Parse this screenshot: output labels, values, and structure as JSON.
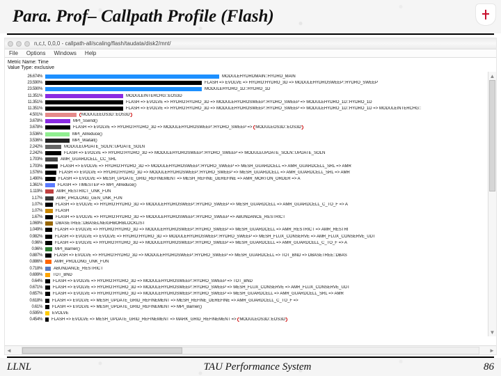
{
  "slide": {
    "title": "Para. Prof– Callpath Profile (Flash)",
    "footer_left": "LLNL",
    "footer_center": "TAU Performance System",
    "footer_right": "86"
  },
  "window": {
    "title": "n,c,t, 0,0,0 - callpath-all/scaling/flash/taudata/disk2/mnt/",
    "menus": [
      "File",
      "Options",
      "Windows",
      "Help"
    ],
    "metric_name": "Metric Name: Time",
    "value_type": "Value Type: exclusive"
  },
  "rows": [
    {
      "pct": "26.674%",
      "color": "#1d90ff",
      "len": 250,
      "label": "MODULEHYDROMAIN::HYDRO_MAIN"
    },
    {
      "pct": "23.590%",
      "color": "#000000",
      "len": 225,
      "label": "FLASH  =>  EVOLVE  => HYDRO:HYDRO_3D  =>  MODULEHYDROSWEEP::HYDRO_SWEEP"
    },
    {
      "pct": "23.590%",
      "color": "#1d90ff",
      "len": 225,
      "label": "MODULEHYDRO_1D::HYDRO_1D"
    },
    {
      "pct": "11.351%",
      "color": "#8a2be2",
      "len": 112,
      "label": "MODULEINTERCHG::EOS3D"
    },
    {
      "pct": "11.351%",
      "color": "#000000",
      "len": 112,
      "label": "FLASH  =>  EVOLVE  => HYDRO:HYDRO_3D  =>  MODULEHYDROSWEEP::HYDRO_SWEEP  =>  MODULEHYDRO_1D::HYDRO_1D"
    },
    {
      "pct": "11.351%",
      "color": "#000000",
      "len": 112,
      "label": "FLASH  =>  EVOLVE  => HYDRO:HYDRO_3D  =>  MODULEHYDROSWEEP::HYDRO_SWEEP  =>  MODULEHYDRO_1D::HYDRO_1D  =>  MODULEINTERCHG::"
    },
    {
      "pct": "4.501%",
      "color": "#e68a8a",
      "len": 45,
      "label": "MODULEEOS3D::EOS3D",
      "mark": true
    },
    {
      "pct": "3.678%",
      "color": "#8a2be2",
      "len": 36,
      "label": "MPI_Ssend()"
    },
    {
      "pct": "3.678%",
      "color": "#000000",
      "len": 36,
      "label": "FLASH  =>  EVOLVE  =>  HYDRO:HYDRO_3D  =>  MODULEHYDROSWEEP::HYDRO_SWEEP  =>  MODULEOS3D::EOS3D",
      "mark2": true
    },
    {
      "pct": "3.536%",
      "color": "#90ee90",
      "len": 35,
      "label": "MPI_Allreduce()"
    },
    {
      "pct": "3.536%",
      "color": "#222222",
      "len": 35,
      "label": "MPI_Waitall()"
    },
    {
      "pct": "2.242%",
      "color": "#666666",
      "len": 23,
      "label": "MODULEUPDATE_SOLN::UPDATE_SOLN"
    },
    {
      "pct": "2.242%",
      "color": "#000000",
      "len": 23,
      "label": "FLASH  =>  EVOLVE  => HYDRO:HYDRO_3D  =>  MODULEHYDROSWEEP::HYDRO_SWEEP  =>  MODULEUPDATE_SOLN::UPDATE_SOLN"
    },
    {
      "pct": "1.703%",
      "color": "#444444",
      "len": 18,
      "label": "AMR_GUARDCELL_CC_SRL"
    },
    {
      "pct": "1.703%",
      "color": "#000000",
      "len": 18,
      "label": "FLASH  =>  EVOLVE  =>  HYDRO:HYDRO_3D  =>  MODULEHYDROSWEEP::HYDRO_SWEEP  =>  MESH_GUARDCELL  =>  AMR_GUARDCELL_SRL  =>  AMR"
    },
    {
      "pct": "1.576%",
      "color": "#000000",
      "len": 16,
      "label": "FLASH  =>  EVOLVE  =>  HYDRO:HYDRO_3D  =>  MODULEHYDROSWEEP::HYDRO_SWEEP  =>  MESH_GUARDCELL  =>  AMR_GUARDCELL_SRL  =>  AMR"
    },
    {
      "pct": "1.490%",
      "color": "#000000",
      "len": 15,
      "label": "FLASH  =>  EVOLVE  =>  MESH_UPDATE_GRID_REFINEMENT  =>  MESH_REFINE_DEREFINE  =>  AMR_MORTON_ORDER  =>  A"
    },
    {
      "pct": "1.361%",
      "color": "#5a7aff",
      "len": 14,
      "label": "FLASH  =>  TIMESTEP  =>  MPI_Allreduce()"
    },
    {
      "pct": "1.119%",
      "color": "#c04040",
      "len": 12,
      "label": "AMR_RESTRICT_UNK_FUN"
    },
    {
      "pct": "1.17%",
      "color": "#3a3a3a",
      "len": 12,
      "label": "AMR_PROLONG_GEN_UNK_FUN"
    },
    {
      "pct": "1.07%",
      "color": "#000000",
      "len": 11,
      "label": "FLASH  =>  EVOLVE  => HYDRO:HYDRO_3D  =>  MODULEHYDROSWEEP::HYDRO_SWEEP  =>  MESH_GUARDCELL  =>  AMR_GUARDCELL_C_TO_F  =>  A"
    },
    {
      "pct": "1.07%",
      "color": "#cc8800",
      "len": 11,
      "label": "FLASH"
    },
    {
      "pct": "1.67%",
      "color": "#000000",
      "len": 11,
      "label": "FLASH  =>  EVOLVE  =>  HYDRO:HYDRO_3D  =>  MODULEHYDROSWEEP::HYDRO_SWEEP  =>  ABUNDANCE_RESTRICT"
    },
    {
      "pct": "1.069%",
      "color": "#996600",
      "len": 11,
      "label": "DBASETREE::DBASELNEIGHBORBLOCKLIST"
    },
    {
      "pct": "1.049%",
      "color": "#000000",
      "len": 10,
      "label": "FLASH  =>  EVOLVE  =>  HYDRO:HYDRO_3D  =>  MODULEHYDROSWEEP::HYDRO_SWEEP  =>  MESH_GUARDCELL  =>  AMR_RESTRICT  =>  AMR_RESTRI"
    },
    {
      "pct": "0.982%",
      "color": "#000000",
      "len": 10,
      "label": "FLASH  =>  EVOLVE  =>  EVOLVE  =>  HYDRO:HYDRO_3D  =>  MODULEHYDROSWEEP::HYDRO_SWEEP  =>  MESH_FLUX_CONSERVE  =>  AMR_FLUX_CONSERVE_UDT"
    },
    {
      "pct": "0.96%",
      "color": "#000000",
      "len": 10,
      "label": "FLASH  =>  EVOLVE  =>  HYDRO:HYDRO_3D  =>  MODULEHYDROSWEEP::HYDRO_SWEEP  =>  MESH_GUARDCELL  =>  AMR_GUARDCELL_C_TO_F  =>  A"
    },
    {
      "pct": "0.96%",
      "color": "#2e7d32",
      "len": 10,
      "label": "MPI_Barrier()"
    },
    {
      "pct": "0.887%",
      "color": "#000000",
      "len": 9,
      "label": "FLASH  =>  EVOLVE  =>  HYDRO:HYDRO_3D  =>  MODULEHYDROSWEEP::HYDRO_SWEEP  =>  MESH_GUARDCELL  =>  TOT_BND  =>  DBASETREE::DBAS"
    },
    {
      "pct": "0.886%",
      "color": "#ff6600",
      "len": 9,
      "label": "AMR_PROLONG_UNK_FUN"
    },
    {
      "pct": "0.718%",
      "color": "#5b7bc0",
      "len": 8,
      "label": "ABUNDANCE_RESTRICT"
    },
    {
      "pct": "0.699%",
      "color": "#ffa500",
      "len": 7,
      "label": "TOT_BND"
    },
    {
      "pct": "0.64%",
      "color": "#000000",
      "len": 7,
      "label": "FLASH  =>  EVOLVE  => HYDRO:HYDRO_3D  =>  MODULEHYDROSWEEP::HYDRO_SWEEP  =>  TOT_BND"
    },
    {
      "pct": "0.671%",
      "color": "#000000",
      "len": 7,
      "label": "FLASH  =>  EVOLVE  =>  HYDRO:HYDRO_3D  =>  MODULEHYDROSWEEP::HYDRO_SWEEP  =>  MESH_FLUX_CONSERVE  =>  AMR_FLUX_CONSERVE_UDT"
    },
    {
      "pct": "0.657%",
      "color": "#000000",
      "len": 7,
      "label": "FLASH  =>  EVOLVE  =>  HYDRO:HYDRO_3D  =>  MODULEHYDROSWEEP::HYDRO_SWEEP  =>  MESH_GUARDCELL  =>  AMR_GUARDCELL_SRL  =>  AMR"
    },
    {
      "pct": "0.618%",
      "color": "#000000",
      "len": 6,
      "label": "FLASH  =>  EVOLVE  =>  MESH_UPDATE_GRID_REFINEMENT  =>  MESH_REFINE_DEREFINE  =>  AMR_GUARDCELL_C_TO_F  =>"
    },
    {
      "pct": "0.61%",
      "color": "#000000",
      "len": 6,
      "label": "FLASH  =>  EVOLVE  =>  MESH_UPDATE_GRID_REFINEMENT  =>  MPI_Barrier()"
    },
    {
      "pct": "0.595%",
      "color": "#ffcc00",
      "len": 6,
      "label": "EVOLVE"
    },
    {
      "pct": "0.454%",
      "color": "#000000",
      "len": 5,
      "label": "FLASH  =>  EVOLVE  =>  MESH_UPDATE_GRID_REFINEMENT  =>  MARK_GRID_REFINEMENT  =>  MODULEOS3D::EOS3D",
      "mark2": true
    }
  ]
}
